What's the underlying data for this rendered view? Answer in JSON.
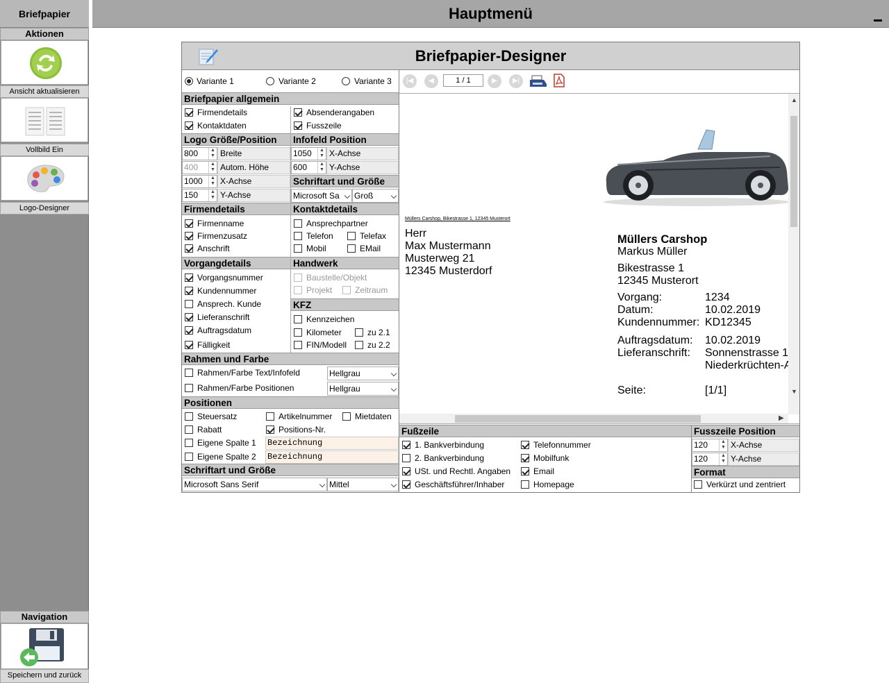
{
  "sidebar": {
    "title": "Briefpapier",
    "actions_header": "Aktionen",
    "actions": [
      {
        "label": "Ansicht aktualisieren",
        "icon": "refresh-icon"
      },
      {
        "label": "Vollbild Ein",
        "icon": "document-lines-icon"
      },
      {
        "label": "Logo-Designer",
        "icon": "palette-icon"
      }
    ],
    "nav_header": "Navigation",
    "nav_action": {
      "label": "Speichern und zurück",
      "icon": "save-back-icon"
    }
  },
  "topbar": {
    "title": "Hauptmenü"
  },
  "panel": {
    "title": "Briefpapier-Designer"
  },
  "variants": {
    "selected": 0,
    "options": [
      "Variante 1",
      "Variante 2",
      "Variante 3"
    ]
  },
  "allgemein": {
    "header": "Briefpapier allgemein",
    "items": [
      {
        "label": "Firmendetails",
        "checked": true
      },
      {
        "label": "Absenderangaben",
        "checked": true
      },
      {
        "label": "Kontaktdaten",
        "checked": true
      },
      {
        "label": "Fusszeile",
        "checked": true
      }
    ]
  },
  "logo": {
    "header": "Logo Größe/Position",
    "rows": [
      {
        "value": "800",
        "label": "Breite"
      },
      {
        "value": "400",
        "label": "Autom. Höhe"
      },
      {
        "value": "1000",
        "label": "X-Achse"
      },
      {
        "value": "150",
        "label": "Y-Achse"
      }
    ]
  },
  "infofeld": {
    "header": "Infofeld Position",
    "rows": [
      {
        "value": "1050",
        "label": "X-Achse"
      },
      {
        "value": "600",
        "label": "Y-Achse"
      }
    ]
  },
  "schrift_top": {
    "header": "Schriftart und Größe",
    "font": "Microsoft Sa",
    "size": "Groß"
  },
  "firmendetails": {
    "header": "Firmendetails",
    "items": [
      {
        "label": "Firmenname",
        "checked": true
      },
      {
        "label": "Firmenzusatz",
        "checked": true
      },
      {
        "label": "Anschrift",
        "checked": true
      }
    ]
  },
  "kontaktdetails": {
    "header": "Kontaktdetails",
    "items": [
      {
        "label": "Ansprechpartner",
        "checked": false
      },
      {
        "label": "Telefon",
        "checked": false
      },
      {
        "label": "Telefax",
        "checked": false
      },
      {
        "label": "Mobil",
        "checked": false
      },
      {
        "label": "EMail",
        "checked": false
      }
    ]
  },
  "vorgang": {
    "header": "Vorgangdetails",
    "items": [
      {
        "label": "Vorgangsnummer",
        "checked": true
      },
      {
        "label": "Kundennummer",
        "checked": true
      },
      {
        "label": "Ansprech. Kunde",
        "checked": false
      },
      {
        "label": "Lieferanschrift",
        "checked": true
      },
      {
        "label": "Auftragsdatum",
        "checked": true
      },
      {
        "label": "Fälligkeit",
        "checked": true
      }
    ]
  },
  "handwerk": {
    "header": "Handwerk",
    "items": [
      {
        "label": "Baustelle/Objekt",
        "checked": false
      },
      {
        "label": "Projekt",
        "checked": false
      },
      {
        "label": "Zeitraum",
        "checked": false
      }
    ]
  },
  "kfz": {
    "header": "KFZ",
    "items": [
      {
        "label": "Kennzeichen",
        "checked": false
      },
      {
        "label": "Kilometer",
        "checked": false
      },
      {
        "label": "zu 2.1",
        "checked": false
      },
      {
        "label": "FIN/Modell",
        "checked": false
      },
      {
        "label": "zu 2.2",
        "checked": false
      }
    ]
  },
  "rahmen": {
    "header": "Rahmen und Farbe",
    "rows": [
      {
        "label": "Rahmen/Farbe Text/Infofeld",
        "checked": false,
        "value": "Hellgrau"
      },
      {
        "label": "Rahmen/Farbe Positionen",
        "checked": false,
        "value": "Hellgrau"
      }
    ]
  },
  "positionen": {
    "header": "Positionen",
    "items": [
      {
        "label": "Steuersatz",
        "checked": false
      },
      {
        "label": "Artikelnummer",
        "checked": false
      },
      {
        "label": "Mietdaten",
        "checked": false
      },
      {
        "label": "Rabatt",
        "checked": false
      },
      {
        "label": "Positions-Nr.",
        "checked": true
      },
      {
        "label": "Eigene Spalte 1",
        "checked": false,
        "value": "Bezeichnung"
      },
      {
        "label": "Eigene Spalte 2",
        "checked": false,
        "value": "Bezeichnung"
      }
    ]
  },
  "schrift_bottom": {
    "header": "Schriftart und Größe",
    "font": "Microsoft Sans Serif",
    "size": "Mittel"
  },
  "toolbar": {
    "page": "1 / 1"
  },
  "preview": {
    "sender_line": "Müllers Carshop, Bikestrasse 1, 12345 Musterort",
    "recipient": [
      "Herr",
      "Max Mustermann",
      "Musterweg 21",
      "12345 Musterdorf"
    ],
    "company_name": "Müllers Carshop",
    "contact": "Markus Müller",
    "street": "Bikestrasse 1",
    "city": "12345 Musterort",
    "info_labels": [
      "Vorgang:",
      "Datum:",
      "Kundennummer:",
      "Auftragsdatum:",
      "Lieferanschrift:",
      "",
      "Seite:"
    ],
    "info_values": [
      "1234",
      "10.02.2019",
      "KD12345",
      "10.02.2019",
      "Sonnenstrasse 1",
      "Niederkrüchten-A",
      "[1/1]"
    ]
  },
  "fusszeile": {
    "header": "Fußzeile",
    "items": [
      {
        "label": "1. Bankverbindung",
        "checked": true
      },
      {
        "label": "Telefonnummer",
        "checked": true
      },
      {
        "label": "2. Bankverbindung",
        "checked": false
      },
      {
        "label": "Mobilfunk",
        "checked": true
      },
      {
        "label": "USt. und Rechtl. Angaben",
        "checked": true
      },
      {
        "label": "Email",
        "checked": true
      },
      {
        "label": "Geschäftsführer/Inhaber",
        "checked": true
      },
      {
        "label": "Homepage",
        "checked": false
      }
    ]
  },
  "fuss_pos": {
    "header": "Fusszeile Position",
    "rows": [
      {
        "value": "120",
        "label": "X-Achse"
      },
      {
        "value": "120",
        "label": "Y-Achse"
      }
    ]
  },
  "format": {
    "header": "Format",
    "item": {
      "label": "Verkürzt und zentriert",
      "checked": false
    }
  }
}
